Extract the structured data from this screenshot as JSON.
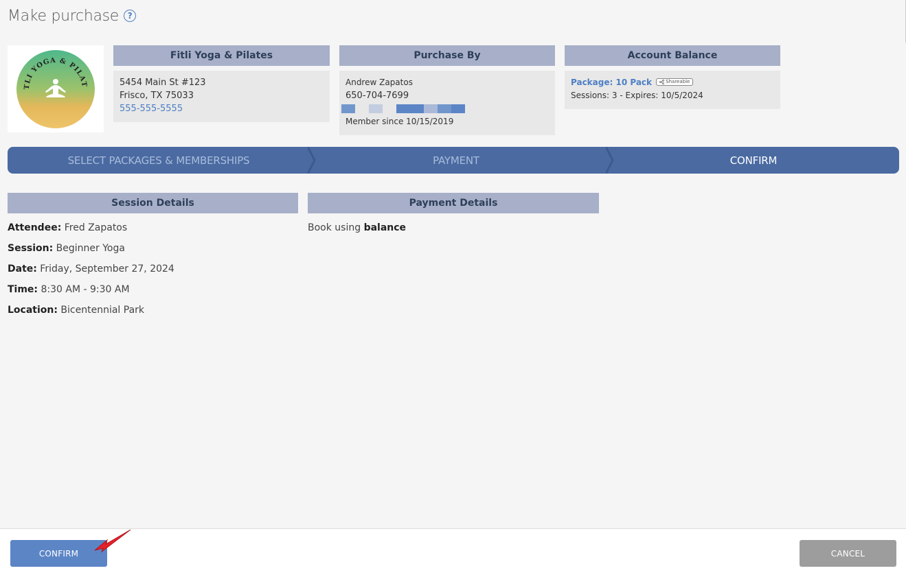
{
  "header": {
    "title": "Make purchase",
    "help_icon": "?"
  },
  "studio": {
    "logo_text": "FITLI YOGA & PILATES",
    "title": "Fitli Yoga & Pilates",
    "address_line1": "5454 Main St #123",
    "address_line2": "Frisco, TX 75033",
    "phone": "555-555-5555"
  },
  "purchaser": {
    "title": "Purchase By",
    "name": "Andrew Zapatos",
    "phone": "650-704-7699",
    "member_since": "Member since 10/15/2019"
  },
  "balance": {
    "title": "Account Balance",
    "package": "Package: 10 Pack",
    "badge": "Shareable",
    "sessions": "Sessions: 3 -  Expires: 10/5/2024"
  },
  "steps": [
    {
      "label": "SELECT PACKAGES & MEMBERSHIPS"
    },
    {
      "label": "PAYMENT"
    },
    {
      "label": "CONFIRM"
    }
  ],
  "session_details": {
    "title": "Session Details",
    "rows": [
      {
        "label": "Attendee:",
        "value": " Fred Zapatos"
      },
      {
        "label": "Session:",
        "value": " Beginner Yoga"
      },
      {
        "label": "Date:",
        "value": " Friday, September 27, 2024"
      },
      {
        "label": "Time:",
        "value": " 8:30 AM - 9:30 AM"
      },
      {
        "label": "Location:",
        "value": " Bicentennial Park"
      }
    ]
  },
  "payment_details": {
    "title": "Payment Details",
    "prefix": "Book using ",
    "method": "balance"
  },
  "footer": {
    "confirm_label": "CONFIRM",
    "cancel_label": "CANCEL"
  },
  "colors": {
    "accent": "#4a6aa1",
    "header_bg": "#a7b0c8",
    "confirm_button": "#5c85c6",
    "cancel_button": "#9d9d9d",
    "arrow": "#e8212a"
  }
}
